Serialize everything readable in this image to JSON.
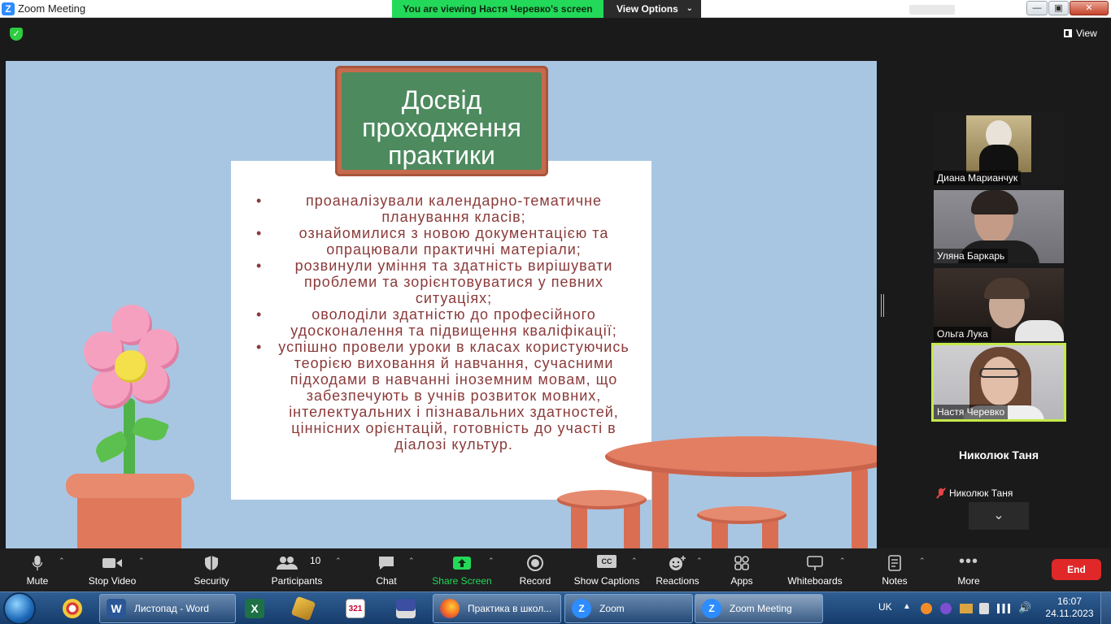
{
  "window": {
    "title": "Zoom Meeting",
    "viewing_banner": "You are viewing Настя Черевко's screen",
    "view_options_label": "View Options"
  },
  "meeting": {
    "view_label": "View"
  },
  "slide": {
    "title_lines": [
      "Досвід",
      "проходження",
      "практики"
    ],
    "bullets": [
      "проаналізували календарно-тематичне планування класів;",
      "ознайомилися з новою документацією та опрацювали практичні матеріали;",
      "розвинули уміння та здатність вирішувати проблеми та зорієнтовуватися у певних ситуаціях;",
      "оволоділи здатністю до професійного удосконалення та підвищення кваліфікації;",
      "успішно провели уроки в класах користуючись теорією виховання й навчання, сучасними підходами в навчанні іноземним мовам, що забезпечують в учнів розвиток мовних, інтелектуальних і пізнавальних здатностей, ціннісних орієнтацій, готовність до участі в діалозі культур."
    ]
  },
  "participants": [
    {
      "name": "Диана Марианчук"
    },
    {
      "name": "Уляна Баркарь"
    },
    {
      "name": "Ольга Лука"
    },
    {
      "name": "Настя Черевко",
      "active": true
    },
    {
      "name": "Николюк Таня",
      "big_name": "Николюк Таня",
      "muted": true
    }
  ],
  "toolbar": {
    "mute": "Mute",
    "stop_video": "Stop Video",
    "security": "Security",
    "participants": "Participants",
    "participants_count": "10",
    "chat": "Chat",
    "share_screen": "Share Screen",
    "record": "Record",
    "show_captions": "Show Captions",
    "reactions": "Reactions",
    "apps": "Apps",
    "whiteboards": "Whiteboards",
    "notes": "Notes",
    "more": "More",
    "end": "End",
    "cc_badge": "CC"
  },
  "taskbar": {
    "items": [
      {
        "label": "Листопад - Word"
      },
      {
        "label": "Практика в школ..."
      },
      {
        "label": "Zoom"
      },
      {
        "label": "Zoom Meeting"
      }
    ],
    "lang": "UK",
    "time": "16:07",
    "date": "24.11.2023",
    "calendar_badge": "321"
  },
  "colors": {
    "zoom_blue": "#2d8cff",
    "banner_green": "#23d959",
    "end_red": "#e02828",
    "active_speaker": "#c5e94a"
  }
}
